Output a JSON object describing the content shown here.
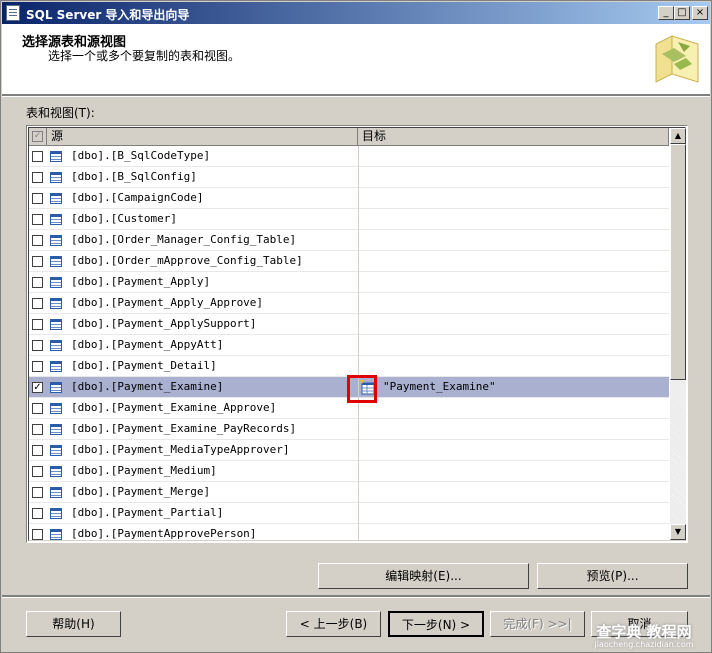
{
  "window": {
    "title": "SQL Server 导入和导出向导",
    "controls": {
      "minimize": "_",
      "maximize": "□",
      "close": "×"
    }
  },
  "header": {
    "title": "选择源表和源视图",
    "subtitle": "选择一个或多个要复制的表和视图。"
  },
  "list": {
    "label": "表和视图(T):",
    "columns": {
      "source": "源",
      "destination": "目标"
    },
    "rows": [
      {
        "source": "[dbo].[B_SqlCodeType]",
        "destination": "",
        "checked": false,
        "selected": false
      },
      {
        "source": "[dbo].[B_SqlConfig]",
        "destination": "",
        "checked": false,
        "selected": false
      },
      {
        "source": "[dbo].[CampaignCode]",
        "destination": "",
        "checked": false,
        "selected": false
      },
      {
        "source": "[dbo].[Customer]",
        "destination": "",
        "checked": false,
        "selected": false
      },
      {
        "source": "[dbo].[Order_Manager_Config_Table]",
        "destination": "",
        "checked": false,
        "selected": false
      },
      {
        "source": "[dbo].[Order_mApprove_Config_Table]",
        "destination": "",
        "checked": false,
        "selected": false
      },
      {
        "source": "[dbo].[Payment_Apply]",
        "destination": "",
        "checked": false,
        "selected": false
      },
      {
        "source": "[dbo].[Payment_Apply_Approve]",
        "destination": "",
        "checked": false,
        "selected": false
      },
      {
        "source": "[dbo].[Payment_ApplySupport]",
        "destination": "",
        "checked": false,
        "selected": false
      },
      {
        "source": "[dbo].[Payment_AppyAtt]",
        "destination": "",
        "checked": false,
        "selected": false
      },
      {
        "source": "[dbo].[Payment_Detail]",
        "destination": "",
        "checked": false,
        "selected": false
      },
      {
        "source": "[dbo].[Payment_Examine]",
        "destination": "\"Payment_Examine\"",
        "checked": true,
        "selected": true
      },
      {
        "source": "[dbo].[Payment_Examine_Approve]",
        "destination": "",
        "checked": false,
        "selected": false
      },
      {
        "source": "[dbo].[Payment_Examine_PayRecords]",
        "destination": "",
        "checked": false,
        "selected": false
      },
      {
        "source": "[dbo].[Payment_MediaTypeApprover]",
        "destination": "",
        "checked": false,
        "selected": false
      },
      {
        "source": "[dbo].[Payment_Medium]",
        "destination": "",
        "checked": false,
        "selected": false
      },
      {
        "source": "[dbo].[Payment_Merge]",
        "destination": "",
        "checked": false,
        "selected": false
      },
      {
        "source": "[dbo].[Payment_Partial]",
        "destination": "",
        "checked": false,
        "selected": false
      },
      {
        "source": "[dbo].[PaymentApprovePerson]",
        "destination": "",
        "checked": false,
        "selected": false
      }
    ]
  },
  "buttons": {
    "edit_mappings": "编辑映射(E)...",
    "preview": "预览(P)...",
    "help": "帮助(H)",
    "back": "< 上一步(B)",
    "next": "下一步(N) >",
    "finish": "完成(F) >>|",
    "cancel": "取消"
  },
  "watermark": {
    "main": "查字典 教程网",
    "sub": "jiaocheng.chazidian.com"
  },
  "colors": {
    "title_bar_start": "#0a246a",
    "title_bar_end": "#a6caf0",
    "selected_row": "#aab0d0",
    "highlight_box": "#e00000"
  }
}
